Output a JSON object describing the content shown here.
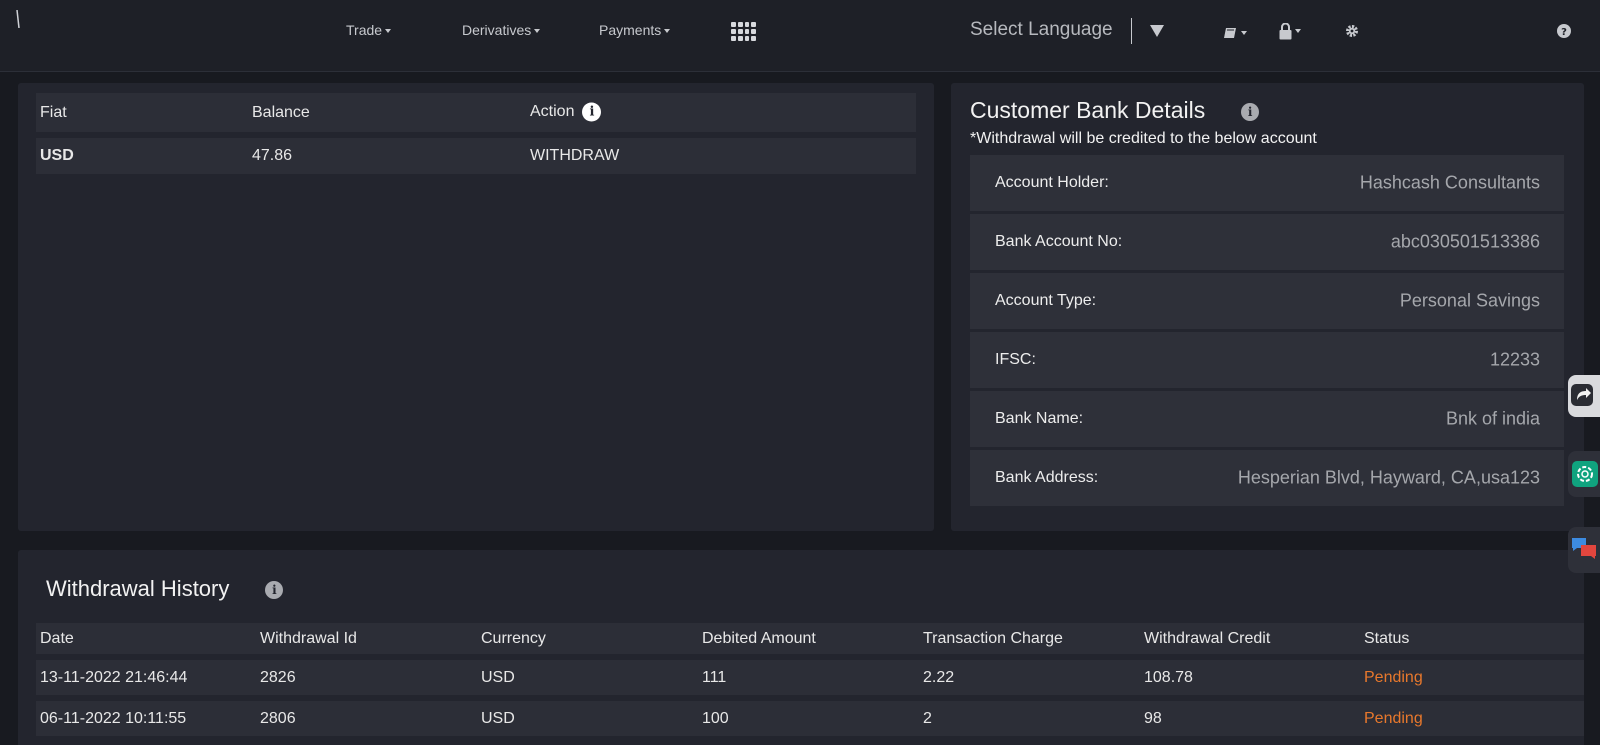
{
  "nav": {
    "trade": "Trade",
    "derivatives": "Derivatives",
    "payments": "Payments",
    "select_language": "Select Language"
  },
  "fiat": {
    "headers": [
      "Fiat",
      "Balance",
      "Action"
    ],
    "rows": [
      {
        "currency": "USD",
        "balance": "47.86",
        "action": "WITHDRAW"
      }
    ]
  },
  "bank": {
    "title": "Customer Bank Details",
    "subtitle": "*Withdrawal will be credited to the below account",
    "rows": [
      {
        "label": "Account Holder:",
        "value": "Hashcash Consultants"
      },
      {
        "label": "Bank Account No:",
        "value": "abc030501513386"
      },
      {
        "label": "Account Type:",
        "value": "Personal Savings"
      },
      {
        "label": "IFSC:",
        "value": "12233"
      },
      {
        "label": "Bank Name:",
        "value": "Bnk of india"
      },
      {
        "label": "Bank Address:",
        "value": "Hesperian Blvd, Hayward, CA,usa123"
      }
    ]
  },
  "history": {
    "title": "Withdrawal History",
    "headers": [
      "Date",
      "Withdrawal Id",
      "Currency",
      "Debited Amount",
      "Transaction Charge",
      "Withdrawal Credit",
      "Status"
    ],
    "rows": [
      {
        "date": "13-11-2022 21:46:44",
        "id": "2826",
        "currency": "USD",
        "debited": "111",
        "charge": "2.22",
        "credit": "108.78",
        "status": "Pending"
      },
      {
        "date": "06-11-2022 10:11:55",
        "id": "2806",
        "currency": "USD",
        "debited": "100",
        "charge": "2",
        "credit": "98",
        "status": "Pending"
      }
    ]
  },
  "icons": {
    "info": "info-icon",
    "grid": "apps-grid-icon",
    "book": "book-icon",
    "lock": "lock-icon",
    "settings": "gear-icon",
    "help": "help-icon",
    "share": "share-icon",
    "chatgpt": "chatgpt-icon",
    "chat": "chat-icon"
  },
  "colors": {
    "pending": "#e8782c",
    "chatgpt": "#10a37f"
  }
}
